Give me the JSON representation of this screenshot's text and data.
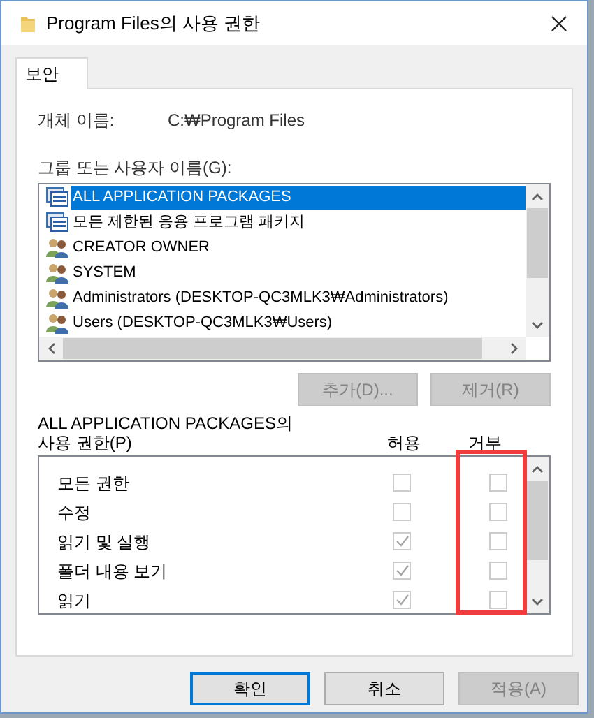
{
  "window": {
    "title": "Program Files의 사용 권한"
  },
  "tabs": [
    {
      "label": "보안",
      "selected": true
    }
  ],
  "object_name": {
    "label": "개체 이름:",
    "value": "C:₩Program Files"
  },
  "principals": {
    "label": "그룹 또는 사용자 이름(G):",
    "items": [
      {
        "kind": "package",
        "name": "ALL APPLICATION PACKAGES",
        "selected": true
      },
      {
        "kind": "package",
        "name": "모든 제한된 응용 프로그램 패키지",
        "selected": false
      },
      {
        "kind": "users",
        "name": "CREATOR OWNER",
        "selected": false
      },
      {
        "kind": "users",
        "name": "SYSTEM",
        "selected": false
      },
      {
        "kind": "users",
        "name": "Administrators (DESKTOP-QC3MLK3₩Administrators)",
        "selected": false
      },
      {
        "kind": "users",
        "name": "Users (DESKTOP-QC3MLK3₩Users)",
        "selected": false
      }
    ]
  },
  "principal_buttons": [
    {
      "label": "추가(D)...",
      "disabled": true
    },
    {
      "label": "제거(R)",
      "disabled": true
    }
  ],
  "permissions": {
    "title_1": "ALL APPLICATION PACKAGES의",
    "title_2": "사용 권한(P)",
    "allow_header": "허용",
    "deny_header": "거부",
    "deny_highlighted": true,
    "rows": [
      {
        "name": "모든 권한",
        "allow": false,
        "deny": false
      },
      {
        "name": "수정",
        "allow": false,
        "deny": false
      },
      {
        "name": "읽기 및 실행",
        "allow": true,
        "deny": false
      },
      {
        "name": "폴더 내용 보기",
        "allow": true,
        "deny": false
      },
      {
        "name": "읽기",
        "allow": true,
        "deny": false
      }
    ]
  },
  "buttons": [
    {
      "label": "확인",
      "default": true,
      "disabled": false
    },
    {
      "label": "취소",
      "default": false,
      "disabled": false
    },
    {
      "label": "적용(A)",
      "default": false,
      "disabled": true
    }
  ]
}
